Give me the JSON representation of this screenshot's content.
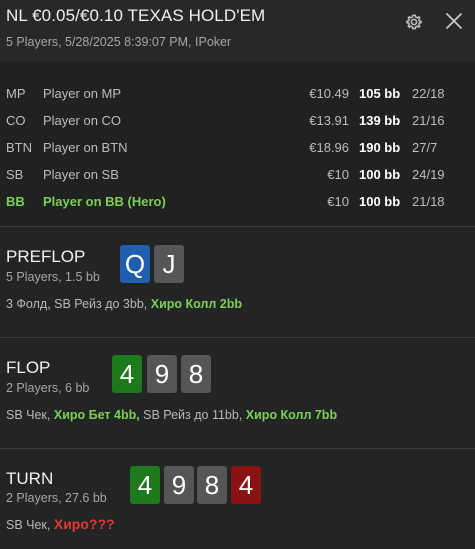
{
  "header": {
    "title": "NL €0.05/€0.10 TEXAS HOLD'EM",
    "subtitle": "5 Players, 5/28/2025 8:39:07 PM, IPoker",
    "settings_icon": "gear-icon",
    "close_icon": "close-icon"
  },
  "players": [
    {
      "pos": "MP",
      "name": "Player on MP",
      "stack": "€10.49",
      "bb": "105 bb",
      "ratio": "22/18"
    },
    {
      "pos": "CO",
      "name": "Player on CO",
      "stack": "€13.91",
      "bb": "139 bb",
      "ratio": "21/16"
    },
    {
      "pos": "BTN",
      "name": "Player on BTN",
      "stack": "€18.96",
      "bb": "190 bb",
      "ratio": "27/7"
    },
    {
      "pos": "SB",
      "name": "Player on SB",
      "stack": "€10",
      "bb": "100 bb",
      "ratio": "24/19"
    },
    {
      "pos": "BB",
      "name": "Player on BB (Hero)",
      "stack": "€10",
      "bb": "100 bb",
      "ratio": "21/18",
      "hero": true
    }
  ],
  "streets": {
    "preflop": {
      "name": "PREFLOP",
      "sub": "5 Players, 1.5 bb",
      "cards": [
        {
          "rank": "Q",
          "color": "#1f5fae"
        },
        {
          "rank": "J",
          "color": "#555755"
        }
      ],
      "action_plain": "3 Фолд, SB Рейз до 3bb, ",
      "action_hero": "Хиро Колл 2bb"
    },
    "flop": {
      "name": "FLOP",
      "sub": "2 Players, 6 bb",
      "cards": [
        {
          "rank": "4",
          "color": "#1c7a1c"
        },
        {
          "rank": "9",
          "color": "#555755"
        },
        {
          "rank": "8",
          "color": "#555755"
        }
      ],
      "action_plain_1": "SB Чек, ",
      "action_hero_1": "Хиро Бет 4bb,",
      "action_plain_2": " SB Рейз до 11bb, ",
      "action_hero_2": "Хиро Колл 7bb"
    },
    "turn": {
      "name": "TURN",
      "sub": "2 Players, 27.6 bb",
      "cards": [
        {
          "rank": "4",
          "color": "#1c7a1c"
        },
        {
          "rank": "9",
          "color": "#555755"
        },
        {
          "rank": "8",
          "color": "#555755"
        },
        {
          "rank": "4",
          "color": "#8b1212"
        }
      ],
      "action_plain": "SB Чек, ",
      "action_hero": "Хиро???"
    }
  }
}
